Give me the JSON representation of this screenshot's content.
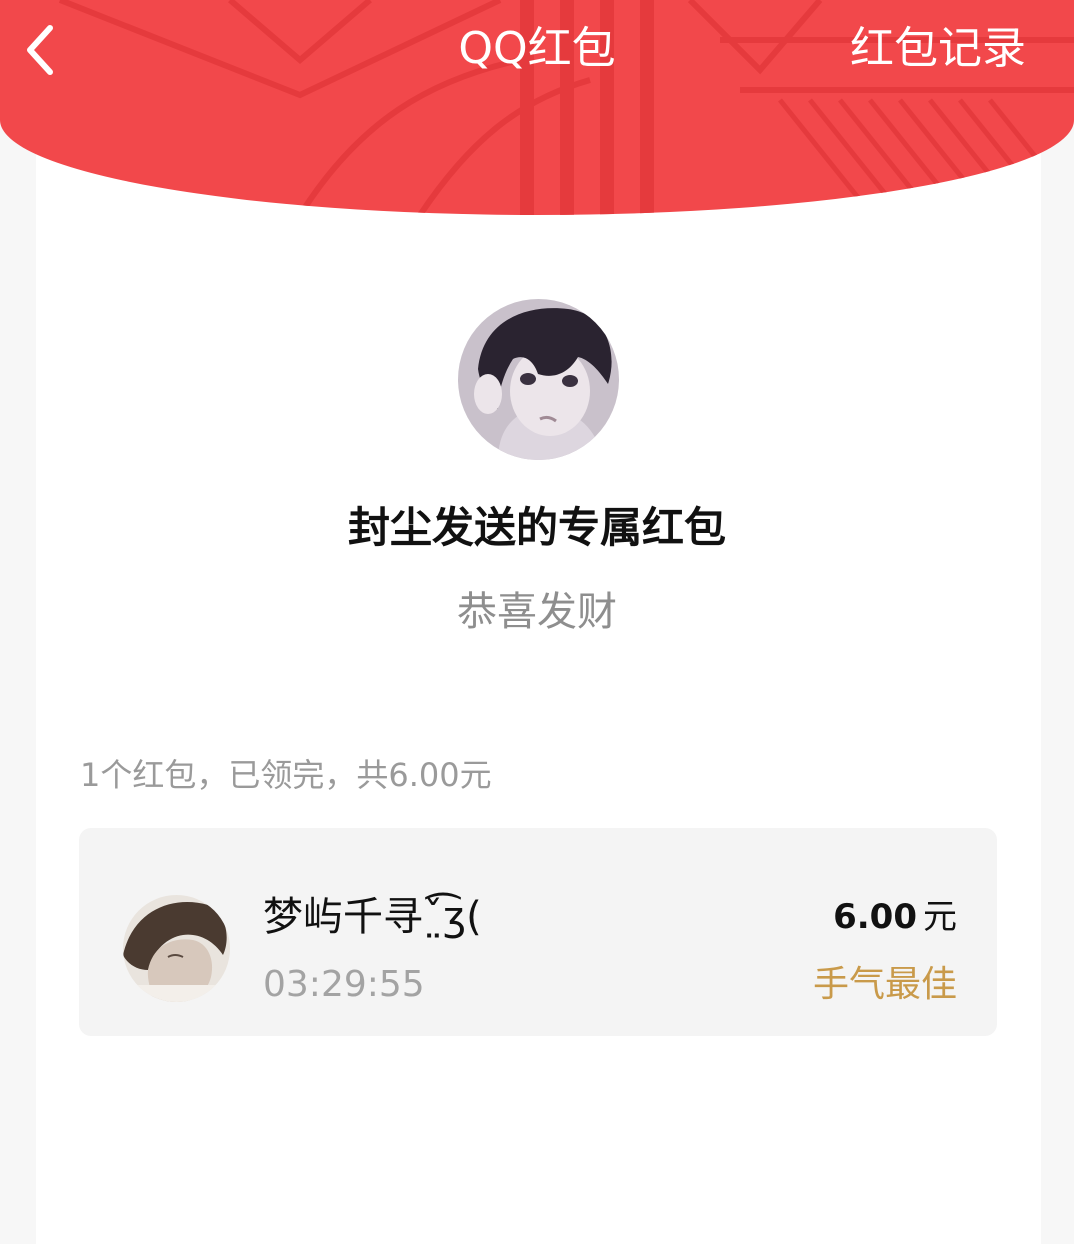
{
  "nav": {
    "title": "QQ红包",
    "records_label": "红包记录"
  },
  "sender": {
    "title": "封尘发送的专属红包",
    "blessing": "恭喜发财"
  },
  "summary": "1个红包，已领完，共6.00元",
  "records": [
    {
      "name": "梦屿千寻ˇ̤͡ʒ(",
      "time": "03:29:55",
      "amount": "6.00",
      "unit": "元",
      "badge": "手气最佳"
    }
  ],
  "colors": {
    "header_red": "#f2484b",
    "best_luck_gold": "#c99a4a"
  }
}
